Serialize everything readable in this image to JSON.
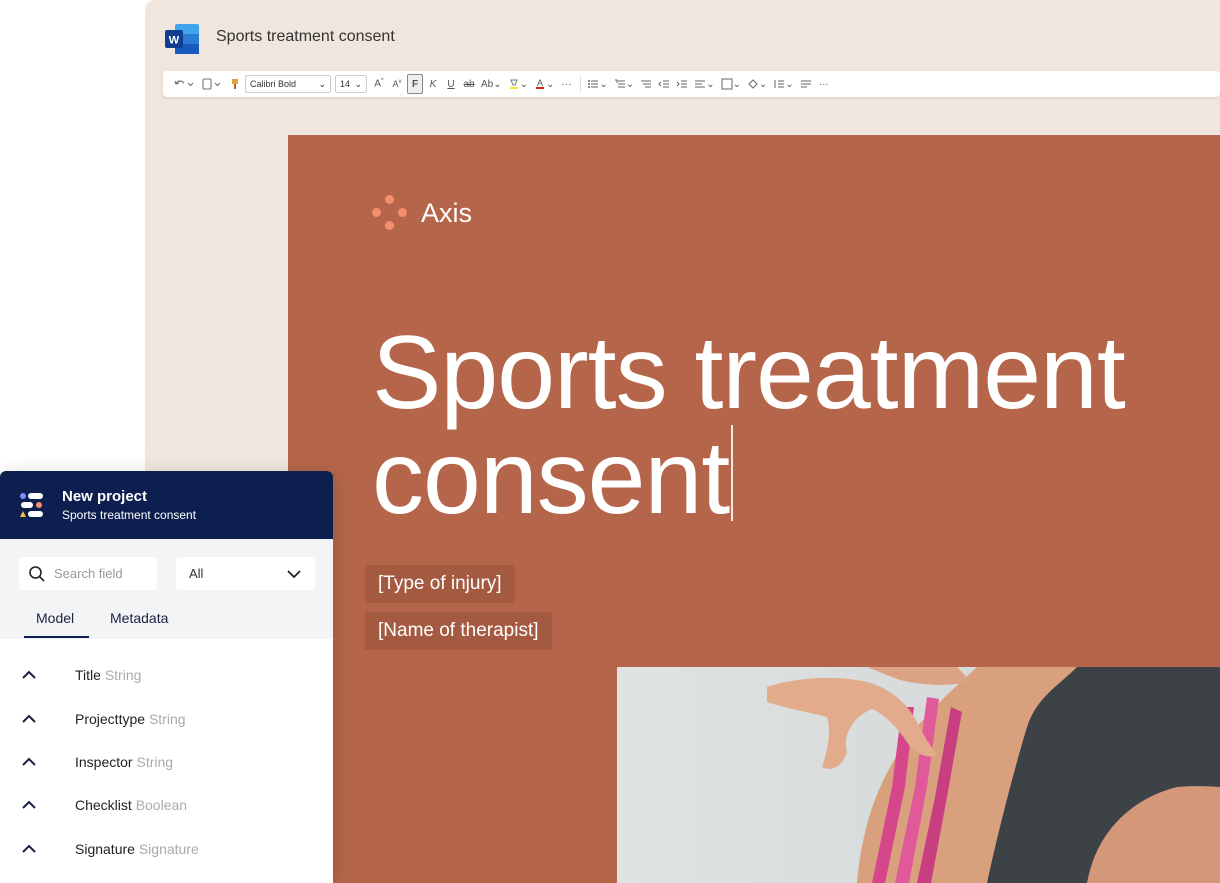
{
  "word": {
    "doc_title": "Sports treatment consent",
    "toolbar": {
      "font_name": "Calibri Bold",
      "font_size": "14",
      "bold_label": "F",
      "italic_label": "K",
      "underline_label": "U",
      "strike_label": "ab",
      "case_label": "Ab",
      "more_label": "···"
    }
  },
  "document": {
    "brand": "Axis",
    "title_line1": "Sports treatment",
    "title_line2": "consent",
    "placeholder_injury": "[Type of injury]",
    "placeholder_therapist": "[Name of therapist]"
  },
  "panel": {
    "project_name": "New project",
    "project_subtitle": "Sports treatment consent",
    "search_placeholder": "Search field",
    "filter_value": "All",
    "tabs": [
      "Model",
      "Metadata"
    ],
    "fields": [
      {
        "name": "Title",
        "type": "String"
      },
      {
        "name": "Projecttype",
        "type": "String"
      },
      {
        "name": "Inspector",
        "type": "String"
      },
      {
        "name": "Checklist",
        "type": "Boolean"
      },
      {
        "name": "Signature",
        "type": "Signature"
      }
    ]
  },
  "colors": {
    "page_bg": "#b5664a",
    "window_bg": "#f0e6dd",
    "panel_header": "#0d1f4e",
    "brand_accent": "#f58e6c",
    "word_blue": "#185abd"
  }
}
